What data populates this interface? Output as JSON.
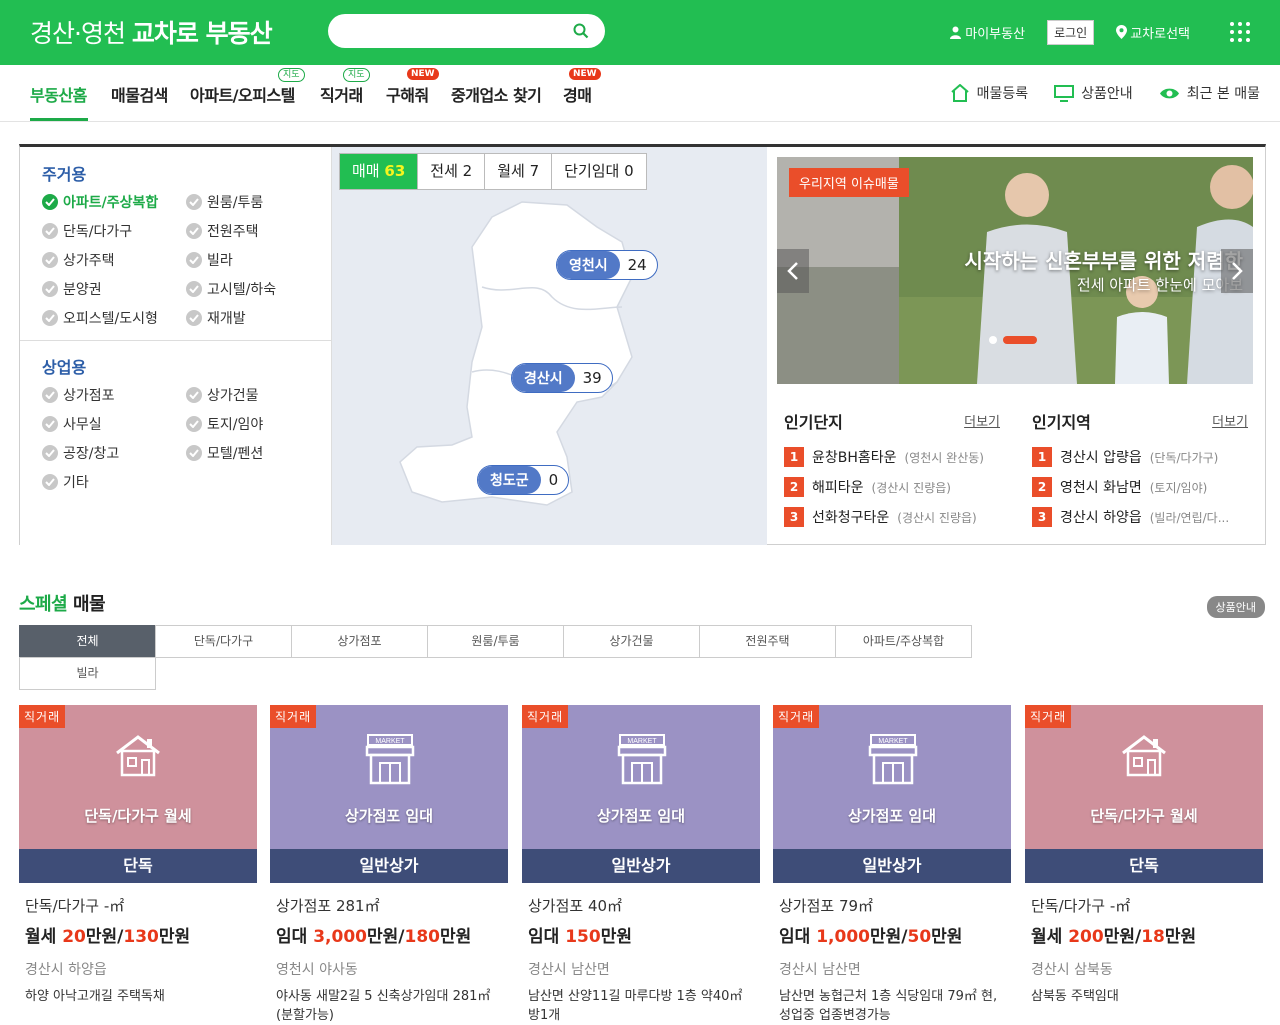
{
  "header": {
    "logo_light": "경산·영천",
    "logo_bold": "교차로 부동산",
    "search_placeholder": "",
    "my_realty": "마이부동산",
    "login": "로그인",
    "region_select": "교차로선택"
  },
  "nav": {
    "items": [
      {
        "label": "부동산홈",
        "badge": ""
      },
      {
        "label": "매물검색",
        "badge": ""
      },
      {
        "label": "아파트/오피스텔",
        "badge": "지도"
      },
      {
        "label": "직거래",
        "badge": "지도"
      },
      {
        "label": "구해줘",
        "badge": "NEW"
      },
      {
        "label": "중개업소 찾기",
        "badge": ""
      },
      {
        "label": "경매",
        "badge": "NEW"
      }
    ],
    "right": [
      "매물등록",
      "상품안내",
      "최근 본 매물"
    ]
  },
  "categories": {
    "residential_title": "주거용",
    "residential": [
      "아파트/주상복합",
      "원룸/투룸",
      "단독/다가구",
      "전원주택",
      "상가주택",
      "빌라",
      "분양권",
      "고시텔/하숙",
      "오피스텔/도시형",
      "재개발"
    ],
    "commercial_title": "상업용",
    "commercial": [
      "상가점포",
      "상가건물",
      "사무실",
      "토지/임야",
      "공장/창고",
      "모텔/펜션",
      "기타"
    ]
  },
  "map": {
    "tabs": [
      {
        "label": "매매",
        "count": "63"
      },
      {
        "label": "전세",
        "count": "2"
      },
      {
        "label": "월세",
        "count": "7"
      },
      {
        "label": "단기임대",
        "count": "0"
      }
    ],
    "pins": [
      {
        "name": "영천시",
        "count": "24"
      },
      {
        "name": "경산시",
        "count": "39"
      },
      {
        "name": "청도군",
        "count": "0"
      }
    ]
  },
  "banner": {
    "tag": "우리지역 이슈매물",
    "title": "시작하는 신혼부부를 위한 저렴한",
    "subtitle": "전세 아파트 한눈에 모아보"
  },
  "popular_complex": {
    "title": "인기단지",
    "more": "더보기",
    "items": [
      {
        "rank": "1",
        "name": "윤창BH홈타운",
        "loc": "(영천시 완산동)"
      },
      {
        "rank": "2",
        "name": "해피타운",
        "loc": "(경산시 진량읍)"
      },
      {
        "rank": "3",
        "name": "선화청구타운",
        "loc": "(경산시 진량읍)"
      }
    ]
  },
  "popular_region": {
    "title": "인기지역",
    "more": "더보기",
    "items": [
      {
        "rank": "1",
        "name": "경산시 압량읍",
        "loc": "(단독/다가구)"
      },
      {
        "rank": "2",
        "name": "영천시 화남면",
        "loc": "(토지/임야)"
      },
      {
        "rank": "3",
        "name": "경산시 하양읍",
        "loc": "(빌라/연립/다..."
      }
    ]
  },
  "special": {
    "title_green": "스페셜",
    "title_rest": " 매물",
    "product_info": "상품안내",
    "filters": [
      "전체",
      "단독/다가구",
      "상가점포",
      "원룸/투룸",
      "상가건물",
      "전원주택",
      "아파트/주상복합",
      "빌라"
    ]
  },
  "listings": [
    {
      "tag": "직거래",
      "card_title": "단독/다가구 월세",
      "bar": "단독",
      "color": "#cf919c",
      "icon": "house-icon",
      "type": "단독/다가구 -㎡",
      "deal": "월세",
      "p1": "20",
      "p2": "130",
      "region": "경산시 하양읍",
      "desc": "하양 아낙고개길 주택독채"
    },
    {
      "tag": "직거래",
      "card_title": "상가점포 임대",
      "bar": "일반상가",
      "color": "#9b92c4",
      "icon": "market-icon",
      "type": "상가점포 281㎡",
      "deal": "임대",
      "p1": "3,000",
      "p2": "180",
      "region": "영천시 야사동",
      "desc": "야사동 새말2길 5 신축상가임대 281㎡(분할가능)"
    },
    {
      "tag": "직거래",
      "card_title": "상가점포 임대",
      "bar": "일반상가",
      "color": "#9b92c4",
      "icon": "market-icon",
      "type": "상가점포 40㎡",
      "deal": "임대",
      "p1": "150",
      "p2": "",
      "region": "경산시 남산면",
      "desc": "남산면 산양11길 마루다방 1층 약40㎡ 방1개"
    },
    {
      "tag": "직거래",
      "card_title": "상가점포 임대",
      "bar": "일반상가",
      "color": "#9b92c4",
      "icon": "market-icon",
      "type": "상가점포 79㎡",
      "deal": "임대",
      "p1": "1,000",
      "p2": "50",
      "region": "경산시 남산면",
      "desc": "남산면 농협근처 1층 식당임대 79㎡ 현,성업중 업종변경가능"
    },
    {
      "tag": "직거래",
      "card_title": "단독/다가구 월세",
      "bar": "단독",
      "color": "#cf919c",
      "icon": "house-icon",
      "type": "단독/다가구 -㎡",
      "deal": "월세",
      "p1": "200",
      "p2": "18",
      "region": "경산시 삼북동",
      "desc": "삼북동 주택임대"
    }
  ],
  "units": {
    "manwon": "만원"
  }
}
